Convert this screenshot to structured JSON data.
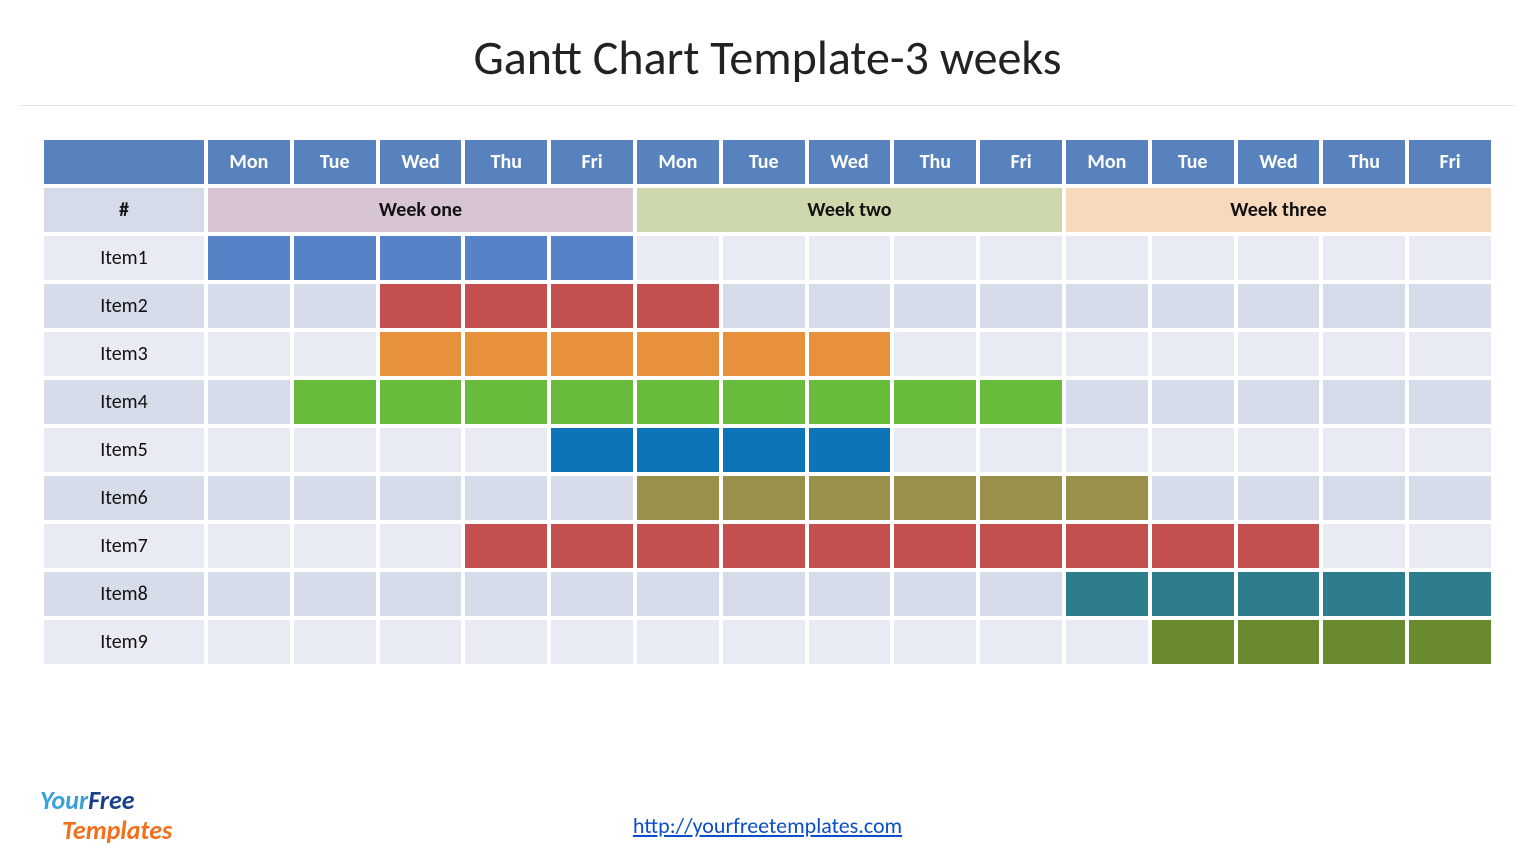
{
  "title": "Gantt Chart Template-3 weeks",
  "days": [
    "Mon",
    "Tue",
    "Wed",
    "Thu",
    "Fri",
    "Mon",
    "Tue",
    "Wed",
    "Thu",
    "Fri",
    "Mon",
    "Tue",
    "Wed",
    "Thu",
    "Fri"
  ],
  "week_hash_label": "#",
  "weeks": [
    {
      "label": "Week one",
      "span": 5,
      "color": "#d8c5d3"
    },
    {
      "label": "Week two",
      "span": 5,
      "color": "#cdd9ac"
    },
    {
      "label": "Week three",
      "span": 5,
      "color": "#f7d9be"
    }
  ],
  "row_bg": {
    "odd": "#e8ebf3",
    "even": "#d7dcea"
  },
  "label_bg": {
    "odd": "#e8ebf3",
    "even": "#d7dcea"
  },
  "items": [
    {
      "label": "Item1",
      "start": 0,
      "end": 4,
      "color": "#5882c8"
    },
    {
      "label": "Item2",
      "start": 2,
      "end": 5,
      "color": "#c44f4f"
    },
    {
      "label": "Item3",
      "start": 2,
      "end": 7,
      "color": "#e7913d"
    },
    {
      "label": "Item4",
      "start": 1,
      "end": 9,
      "color": "#69bb3c"
    },
    {
      "label": "Item5",
      "start": 4,
      "end": 7,
      "color": "#0e74b9"
    },
    {
      "label": "Item6",
      "start": 5,
      "end": 10,
      "color": "#98904b"
    },
    {
      "label": "Item7",
      "start": 3,
      "end": 12,
      "color": "#c44f4f"
    },
    {
      "label": "Item8",
      "start": 10,
      "end": 14,
      "color": "#2e7d8c"
    },
    {
      "label": "Item9",
      "start": 11,
      "end": 14,
      "color": "#6a8a2f"
    }
  ],
  "logo": {
    "your": "Your",
    "free": "Free",
    "templates": "Templates"
  },
  "url": "http://yourfreetemplates.com",
  "chart_data": {
    "type": "gantt",
    "title": "Gantt Chart Template-3 weeks",
    "columns": [
      "Mon",
      "Tue",
      "Wed",
      "Thu",
      "Fri",
      "Mon",
      "Tue",
      "Wed",
      "Thu",
      "Fri",
      "Mon",
      "Tue",
      "Wed",
      "Thu",
      "Fri"
    ],
    "groups": [
      {
        "name": "Week one",
        "columns": [
          0,
          1,
          2,
          3,
          4
        ]
      },
      {
        "name": "Week two",
        "columns": [
          5,
          6,
          7,
          8,
          9
        ]
      },
      {
        "name": "Week three",
        "columns": [
          10,
          11,
          12,
          13,
          14
        ]
      }
    ],
    "tasks": [
      {
        "name": "Item1",
        "start": 0,
        "end": 4
      },
      {
        "name": "Item2",
        "start": 2,
        "end": 5
      },
      {
        "name": "Item3",
        "start": 2,
        "end": 7
      },
      {
        "name": "Item4",
        "start": 1,
        "end": 9
      },
      {
        "name": "Item5",
        "start": 4,
        "end": 7
      },
      {
        "name": "Item6",
        "start": 5,
        "end": 10
      },
      {
        "name": "Item7",
        "start": 3,
        "end": 12
      },
      {
        "name": "Item8",
        "start": 10,
        "end": 14
      },
      {
        "name": "Item9",
        "start": 11,
        "end": 14
      }
    ]
  }
}
